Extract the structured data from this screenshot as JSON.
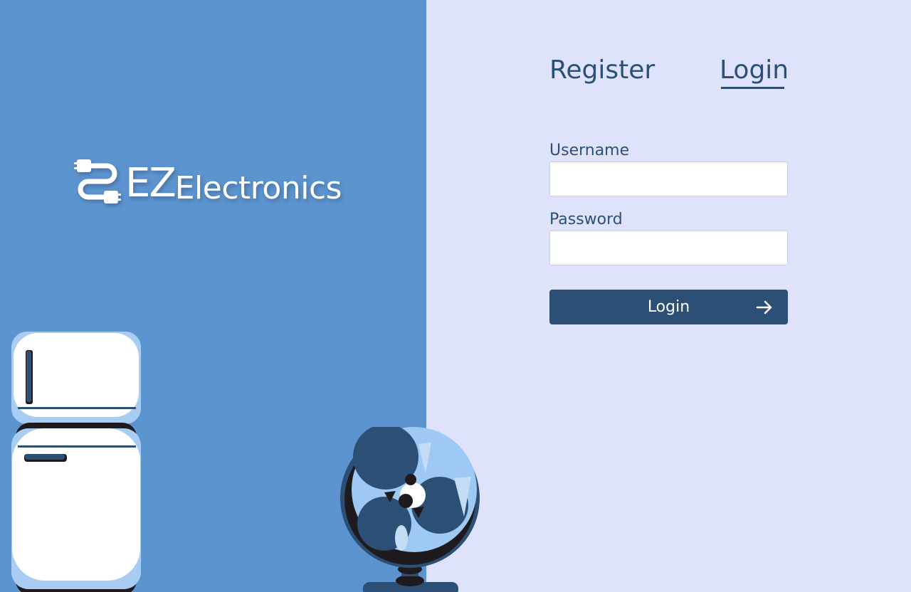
{
  "brand": {
    "name_prefix": "EZ",
    "name_suffix": "Electronics",
    "logo_icon": "cable-plug-icon"
  },
  "tabs": [
    {
      "label": "Register",
      "active": false
    },
    {
      "label": "Login",
      "active": true
    }
  ],
  "form": {
    "username": {
      "label": "Username",
      "value": "",
      "placeholder": ""
    },
    "password": {
      "label": "Password",
      "value": "",
      "placeholder": ""
    },
    "submit": {
      "label": "Login",
      "icon": "arrow-right-icon"
    }
  },
  "illustrations": {
    "left": "refrigerator-illustration",
    "bottom": "fan-illustration"
  },
  "colors": {
    "left_panel": "#5c94d0",
    "right_panel": "#dee2fb",
    "primary": "#2c5075",
    "white": "#ffffff"
  }
}
